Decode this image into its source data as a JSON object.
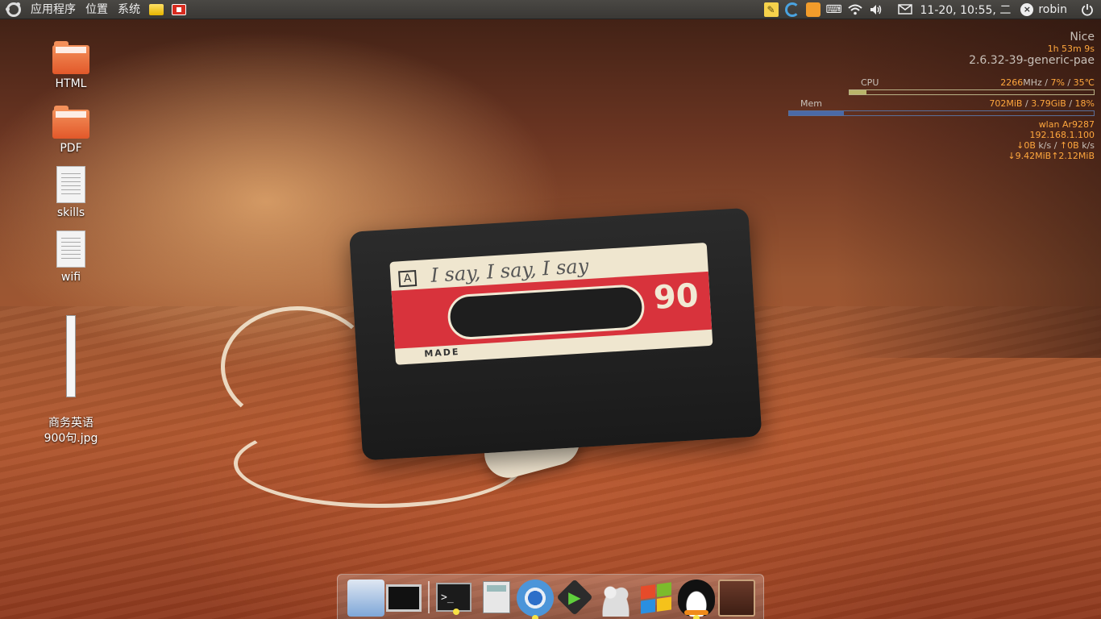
{
  "panel": {
    "menu": [
      "应用程序",
      "位置",
      "系统"
    ],
    "clock": "11-20, 10:55, 二",
    "user": "robin",
    "icons": [
      "ubuntu-logo-icon",
      "folder-icon",
      "app-launcher-icon",
      "sticky-notes-icon",
      "swirl-icon",
      "ime-icon",
      "keyboard-icon",
      "wifi-icon",
      "volume-icon",
      "mail-icon",
      "close-icon",
      "power-icon"
    ]
  },
  "desktop": {
    "icons": [
      {
        "label": "HTML",
        "type": "folder"
      },
      {
        "label": "PDF",
        "type": "folder"
      },
      {
        "label": "skills",
        "type": "document"
      },
      {
        "label": "wifi",
        "type": "document"
      },
      {
        "label": "商务英语\n900句.jpg",
        "type": "image"
      }
    ]
  },
  "conky": {
    "title": "Nice",
    "uptime": "1h 53m 9s",
    "kernel": "2.6.32-39-generic-pae",
    "cpu_label": "CPU",
    "cpu_mhz": "2266",
    "cpu_mhz_unit": "MHz /",
    "cpu_pct": "7%",
    "cpu_sep": "/",
    "cpu_temp": "35℃",
    "cpu_bar_fraction": 0.07,
    "mem_label": "Mem",
    "mem_used": "702MiB",
    "mem_sep1": "/",
    "mem_total": "3.79GiB",
    "mem_sep2": "/",
    "mem_pct": "18%",
    "mem_bar_fraction": 0.18,
    "net_iface": "wlan Ar9287",
    "net_ip": "192.168.1.100",
    "net_down_rate": "↓0B",
    "net_rate_unit": "k/s /",
    "net_up_rate": "↑0B",
    "net_rate_unit2": "k/s",
    "net_down_total": "↓9.42MiB",
    "net_up_total": "↑2.12MiB"
  },
  "wallpaper": {
    "label_letter": "A",
    "handwriting": "I say, I say, I say",
    "number": "90",
    "brand": "MADE"
  },
  "dock": {
    "items": [
      "file-manager-icon",
      "desktop-screen-icon",
      "terminal-icon",
      "calculator-icon",
      "chromium-icon",
      "media-player-icon",
      "users-icon",
      "windows-icon",
      "qq-penguin-icon",
      "book-icon"
    ],
    "terminal_glyph": ">_"
  },
  "colors": {
    "conky_orange": "#ffa73d",
    "conky_grey": "#c8c0b8",
    "panel_bg": "#3e3c38"
  }
}
